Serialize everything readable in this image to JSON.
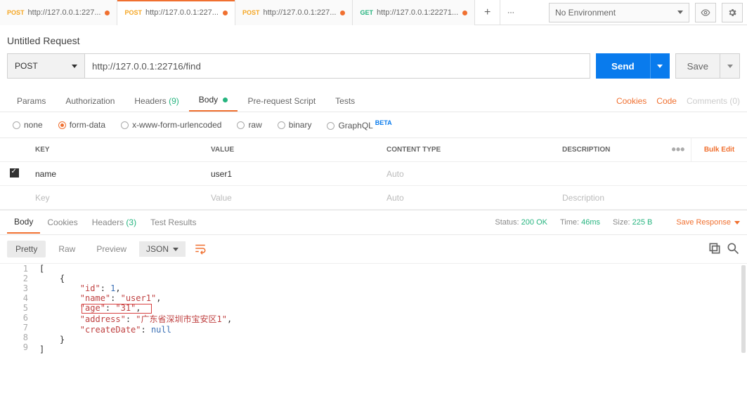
{
  "top": {
    "tabs": [
      {
        "method": "POST",
        "method_cls": "post",
        "label": "http://127.0.0.1:227...",
        "dot": true,
        "active": false
      },
      {
        "method": "POST",
        "method_cls": "post",
        "label": "http://127.0.0.1:227...",
        "dot": true,
        "active": true
      },
      {
        "method": "POST",
        "method_cls": "post",
        "label": "http://127.0.0.1:227...",
        "dot": true,
        "active": false
      },
      {
        "method": "GET",
        "method_cls": "get",
        "label": "http://127.0.0.1:22271...",
        "dot": true,
        "active": false
      }
    ],
    "env": "No Environment"
  },
  "request": {
    "title": "Untitled Request",
    "method": "POST",
    "url": "http://127.0.0.1:22716/find",
    "send": "Send",
    "save": "Save",
    "tabs": {
      "params": "Params",
      "auth": "Authorization",
      "headers": "Headers",
      "headers_count": "(9)",
      "body": "Body",
      "prereq": "Pre-request Script",
      "tests": "Tests",
      "cookies": "Cookies",
      "code": "Code",
      "comments": "Comments (0)"
    },
    "body_types": {
      "none": "none",
      "formdata": "form-data",
      "xwww": "x-www-form-urlencoded",
      "raw": "raw",
      "binary": "binary",
      "graphql": "GraphQL",
      "beta": "BETA"
    },
    "kv": {
      "headers": {
        "key": "KEY",
        "value": "VALUE",
        "type": "CONTENT TYPE",
        "desc": "DESCRIPTION"
      },
      "rows": [
        {
          "checked": true,
          "key": "name",
          "value": "user1",
          "type": "Auto",
          "type_placeholder": true
        }
      ],
      "empty": {
        "key": "Key",
        "value": "Value",
        "type": "Auto",
        "desc": "Description"
      },
      "bulk": "Bulk Edit"
    }
  },
  "response": {
    "tabs": {
      "body": "Body",
      "cookies": "Cookies",
      "headers": "Headers",
      "headers_count": "(3)",
      "tests": "Test Results"
    },
    "status_label": "Status:",
    "status_val": "200 OK",
    "time_label": "Time:",
    "time_val": "46ms",
    "size_label": "Size:",
    "size_val": "225 B",
    "save": "Save Response",
    "view": {
      "pretty": "Pretty",
      "raw": "Raw",
      "preview": "Preview",
      "format": "JSON"
    },
    "code_lines": [
      "[",
      "    {",
      "        \"id\": 1,",
      "        \"name\": \"user1\",",
      "        \"age\": \"31\",",
      "        \"address\": \"广东省深圳市宝安区1\",",
      "        \"createDate\": null",
      "    }",
      "]"
    ]
  },
  "chart_data": {
    "type": "table",
    "rows": [
      {
        "id": 1,
        "name": "user1",
        "age": "31",
        "address": "广东省深圳市宝安区1",
        "createDate": null
      }
    ]
  }
}
